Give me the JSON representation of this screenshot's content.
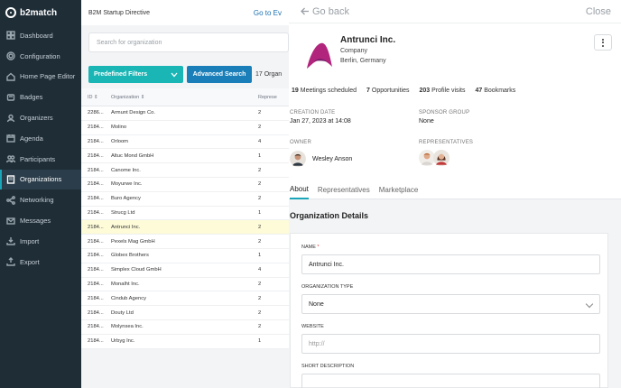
{
  "app": {
    "logo_text": "b2match"
  },
  "topbar": {
    "title": "B2M Startup Directive",
    "goto": "Go to Ev"
  },
  "sidebar": {
    "items": [
      {
        "label": "Dashboard",
        "icon": "dashboard-icon"
      },
      {
        "label": "Configuration",
        "icon": "gear-icon"
      },
      {
        "label": "Home Page Editor",
        "icon": "home-icon"
      },
      {
        "label": "Badges",
        "icon": "badge-icon"
      },
      {
        "label": "Organizers",
        "icon": "organizers-icon"
      },
      {
        "label": "Agenda",
        "icon": "agenda-icon"
      },
      {
        "label": "Participants",
        "icon": "participants-icon"
      },
      {
        "label": "Organizations",
        "icon": "organizations-icon",
        "active": true
      },
      {
        "label": "Networking",
        "icon": "networking-icon"
      },
      {
        "label": "Messages",
        "icon": "messages-icon"
      },
      {
        "label": "Import",
        "icon": "import-icon"
      },
      {
        "label": "Export",
        "icon": "export-icon"
      }
    ]
  },
  "list": {
    "search_placeholder": "Search for organization",
    "predefined_filters": "Predefined Filters",
    "advanced_search": "Advanced Search",
    "count": "17 Organ",
    "columns": {
      "id": "ID",
      "organization": "Organization",
      "representatives": "Represe"
    },
    "rows": [
      {
        "id": "2286...",
        "org": "Armunt Design Co.",
        "rep": "2"
      },
      {
        "id": "2184...",
        "org": "Molino",
        "rep": "2"
      },
      {
        "id": "2184...",
        "org": "Orloom",
        "rep": "4"
      },
      {
        "id": "2184...",
        "org": "Altuc Mond GmbH",
        "rep": "1"
      },
      {
        "id": "2184...",
        "org": "Canome Inc.",
        "rep": "2"
      },
      {
        "id": "2184...",
        "org": "Moyurwe Inc.",
        "rep": "2"
      },
      {
        "id": "2184...",
        "org": "Buro Agency",
        "rep": "2"
      },
      {
        "id": "2184...",
        "org": "Strucg Ltd",
        "rep": "1"
      },
      {
        "id": "2184...",
        "org": "Antrunci Inc.",
        "rep": "2",
        "highlight": true
      },
      {
        "id": "2184...",
        "org": "Pexels Mag GmbH",
        "rep": "2"
      },
      {
        "id": "2184...",
        "org": "Globex Brothers",
        "rep": "1"
      },
      {
        "id": "2184...",
        "org": "Simplex Cloud GmbH",
        "rep": "4"
      },
      {
        "id": "2184...",
        "org": "Monalht Inc.",
        "rep": "2"
      },
      {
        "id": "2184...",
        "org": "Cindub Agency",
        "rep": "2"
      },
      {
        "id": "2184...",
        "org": "Douty Ltd",
        "rep": "2"
      },
      {
        "id": "2184...",
        "org": "Molynsea Inc.",
        "rep": "2"
      },
      {
        "id": "2184...",
        "org": "Urbyg Inc.",
        "rep": "1"
      }
    ]
  },
  "detail": {
    "go_back": "Go back",
    "close": "Close",
    "name": "Antrunci Inc.",
    "type": "Company",
    "location": "Berlin, Germany",
    "stats": [
      {
        "num": "19",
        "label": "Meetings scheduled"
      },
      {
        "num": "7",
        "label": "Opportunities"
      },
      {
        "num": "203",
        "label": "Profile visits"
      },
      {
        "num": "47",
        "label": "Bookmarks"
      }
    ],
    "creation_label": "CREATION DATE",
    "creation_value": "Jan 27, 2023 at 14:08",
    "sponsor_label": "SPONSOR GROUP",
    "sponsor_value": "None",
    "owner_label": "OWNER",
    "owner_name": "Wesley Anson",
    "reps_label": "REPRESENTATIVES",
    "tabs": [
      "About",
      "Representatives",
      "Marketplace"
    ],
    "section_title": "Organization Details",
    "form": {
      "name_label": "NAME",
      "name_value": "Antrunci Inc.",
      "type_label": "ORGANIZATION TYPE",
      "type_value": "None",
      "website_label": "WEBSITE",
      "website_placeholder": "http://",
      "desc_label": "SHORT DESCRIPTION"
    }
  },
  "colors": {
    "sidebar": "#1f2d37",
    "teal": "#1ab5b5",
    "blue": "#1a7fb8",
    "brand_logo": "#b1257c"
  }
}
